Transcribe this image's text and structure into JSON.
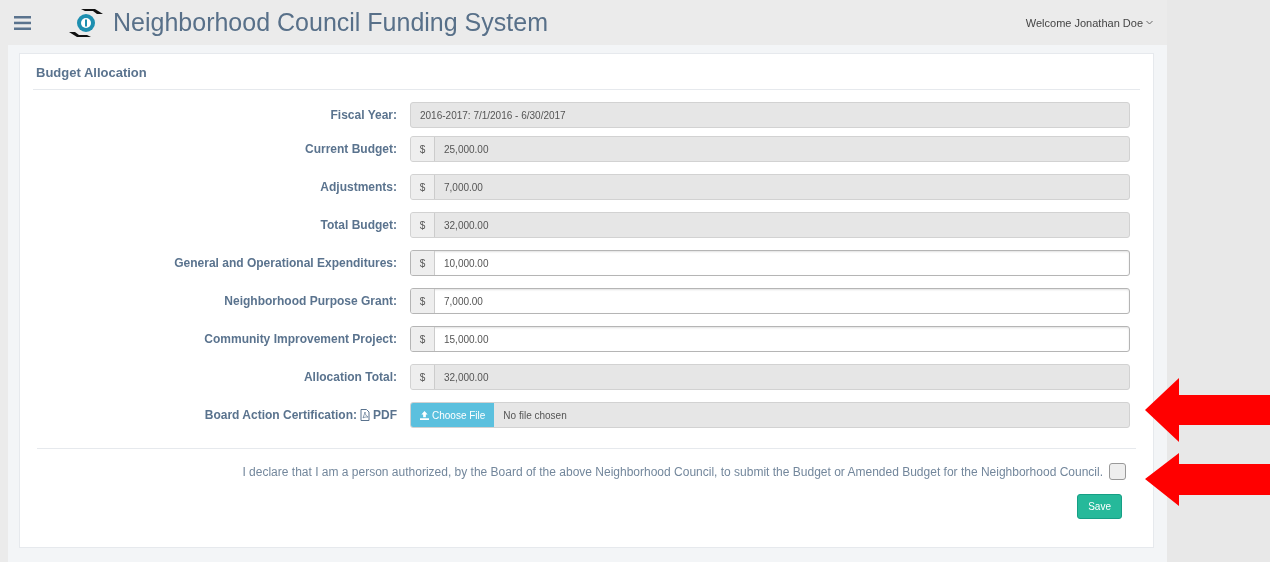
{
  "header": {
    "title": "Neighborhood Council Funding System",
    "user_menu": "Welcome Jonathan Doe"
  },
  "panel": {
    "title": "Budget Allocation",
    "fields": [
      {
        "kind": "text",
        "label": "Fiscal Year:",
        "value": "2016-2017: 7/1/2016 - 6/30/2017",
        "disabled": true
      },
      {
        "kind": "money",
        "label": "Current Budget:",
        "addon": "$",
        "value": "25,000.00",
        "disabled": true
      },
      {
        "kind": "money",
        "label": "Adjustments:",
        "addon": "$",
        "value": "7,000.00",
        "disabled": true
      },
      {
        "kind": "money",
        "label": "Total Budget:",
        "addon": "$",
        "value": "32,000.00",
        "disabled": true
      },
      {
        "kind": "money",
        "label": "General and Operational Expenditures:",
        "addon": "$",
        "value": "10,000.00",
        "disabled": false
      },
      {
        "kind": "money",
        "label": "Neighborhood Purpose Grant:",
        "addon": "$",
        "value": "7,000.00",
        "disabled": false
      },
      {
        "kind": "money",
        "label": "Community Improvement Project:",
        "addon": "$",
        "value": "15,000.00",
        "disabled": false
      },
      {
        "kind": "money",
        "label": "Allocation Total:",
        "addon": "$",
        "value": "32,000.00",
        "disabled": true
      },
      {
        "kind": "file",
        "label": "Board Action Certification:",
        "label_suffix": "PDF",
        "button": "Choose File",
        "value": "No file chosen",
        "disabled": false
      }
    ],
    "declaration": {
      "text": "I declare that I am a person authorized, by the Board of the above Neighborhood Council, to submit the Budget or Amended Budget for the Neighborhood Council.",
      "checked": false
    },
    "save_button": "Save"
  }
}
